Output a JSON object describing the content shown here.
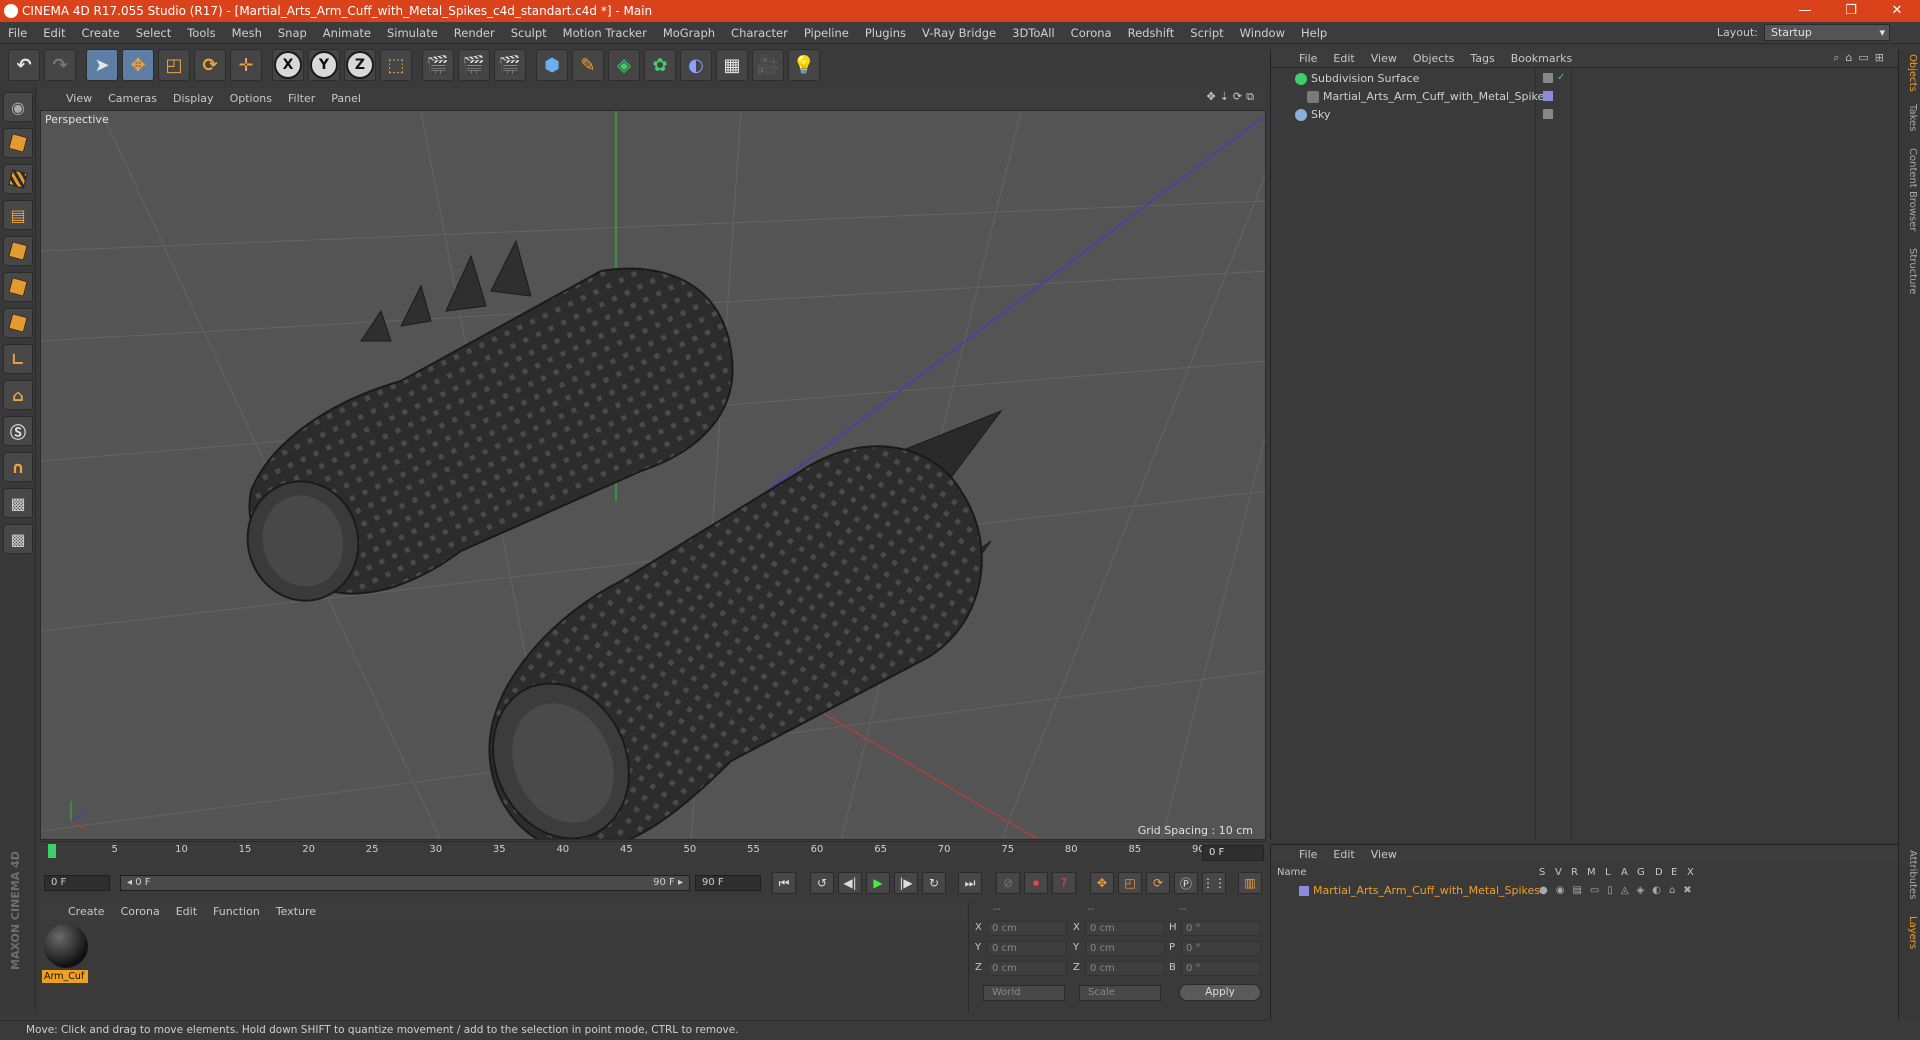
{
  "window": {
    "title": "CINEMA 4D R17.055 Studio (R17) - [Martial_Arts_Arm_Cuff_with_Metal_Spikes_c4d_standart.c4d *] - Main"
  },
  "menu": {
    "items": [
      "File",
      "Edit",
      "Create",
      "Select",
      "Tools",
      "Mesh",
      "Snap",
      "Animate",
      "Simulate",
      "Render",
      "Sculpt",
      "Motion Tracker",
      "MoGraph",
      "Character",
      "Pipeline",
      "Plugins",
      "V-Ray Bridge",
      "3DToAll",
      "Corona",
      "Redshift",
      "Script",
      "Window",
      "Help"
    ],
    "layout_label": "Layout:",
    "layout_value": "Startup"
  },
  "viewport": {
    "menu": [
      "View",
      "Cameras",
      "Display",
      "Options",
      "Filter",
      "Panel"
    ],
    "label": "Perspective",
    "grid_spacing": "Grid Spacing : 10 cm"
  },
  "timeline": {
    "ticks": [
      "0",
      "5",
      "10",
      "15",
      "20",
      "25",
      "30",
      "35",
      "40",
      "45",
      "50",
      "55",
      "60",
      "65",
      "70",
      "75",
      "80",
      "85",
      "90"
    ],
    "current_frame": "0 F"
  },
  "transport": {
    "start_field": "0 F",
    "range_start": "◂ 0 F",
    "range_end": "90 F ▸",
    "end_field": "90 F"
  },
  "material_manager": {
    "menu": [
      "Create",
      "Corona",
      "Edit",
      "Function",
      "Texture"
    ],
    "material_name": "Arm_Cuf"
  },
  "coordinates": {
    "headers": [
      "--",
      "--",
      "--"
    ],
    "rows": [
      {
        "a": "X",
        "av": "0 cm",
        "b": "X",
        "bv": "0 cm",
        "c": "H",
        "cv": "0 °"
      },
      {
        "a": "Y",
        "av": "0 cm",
        "b": "Y",
        "bv": "0 cm",
        "c": "P",
        "cv": "0 °"
      },
      {
        "a": "Z",
        "av": "0 cm",
        "b": "Z",
        "bv": "0 cm",
        "c": "B",
        "cv": "0 °"
      }
    ],
    "world": "World",
    "scale": "Scale",
    "apply": "Apply"
  },
  "status": "Move: Click and drag to move elements. Hold down SHIFT to quantize movement / add to the selection in point mode, CTRL to remove.",
  "object_manager": {
    "menu": [
      "File",
      "Edit",
      "View",
      "Objects",
      "Tags",
      "Bookmarks"
    ],
    "objects": [
      "Subdivision Surface",
      "Martial_Arts_Arm_Cuff_with_Metal_Spikes",
      "Sky"
    ]
  },
  "layer_manager": {
    "menu": [
      "File",
      "Edit",
      "View"
    ],
    "header_name": "Name",
    "columns": [
      "S",
      "V",
      "R",
      "M",
      "L",
      "A",
      "G",
      "D",
      "E",
      "X"
    ],
    "layer_name": "Martial_Arts_Arm_Cuff_with_Metal_Spikes"
  },
  "side_tabs": [
    "Objects",
    "Takes",
    "Content Browser",
    "Structure",
    "Attributes",
    "Layers"
  ],
  "logo": "MAXON CINEMA 4D",
  "colors": {
    "titlebar": "#d9421a",
    "accent": "#f0a020"
  }
}
